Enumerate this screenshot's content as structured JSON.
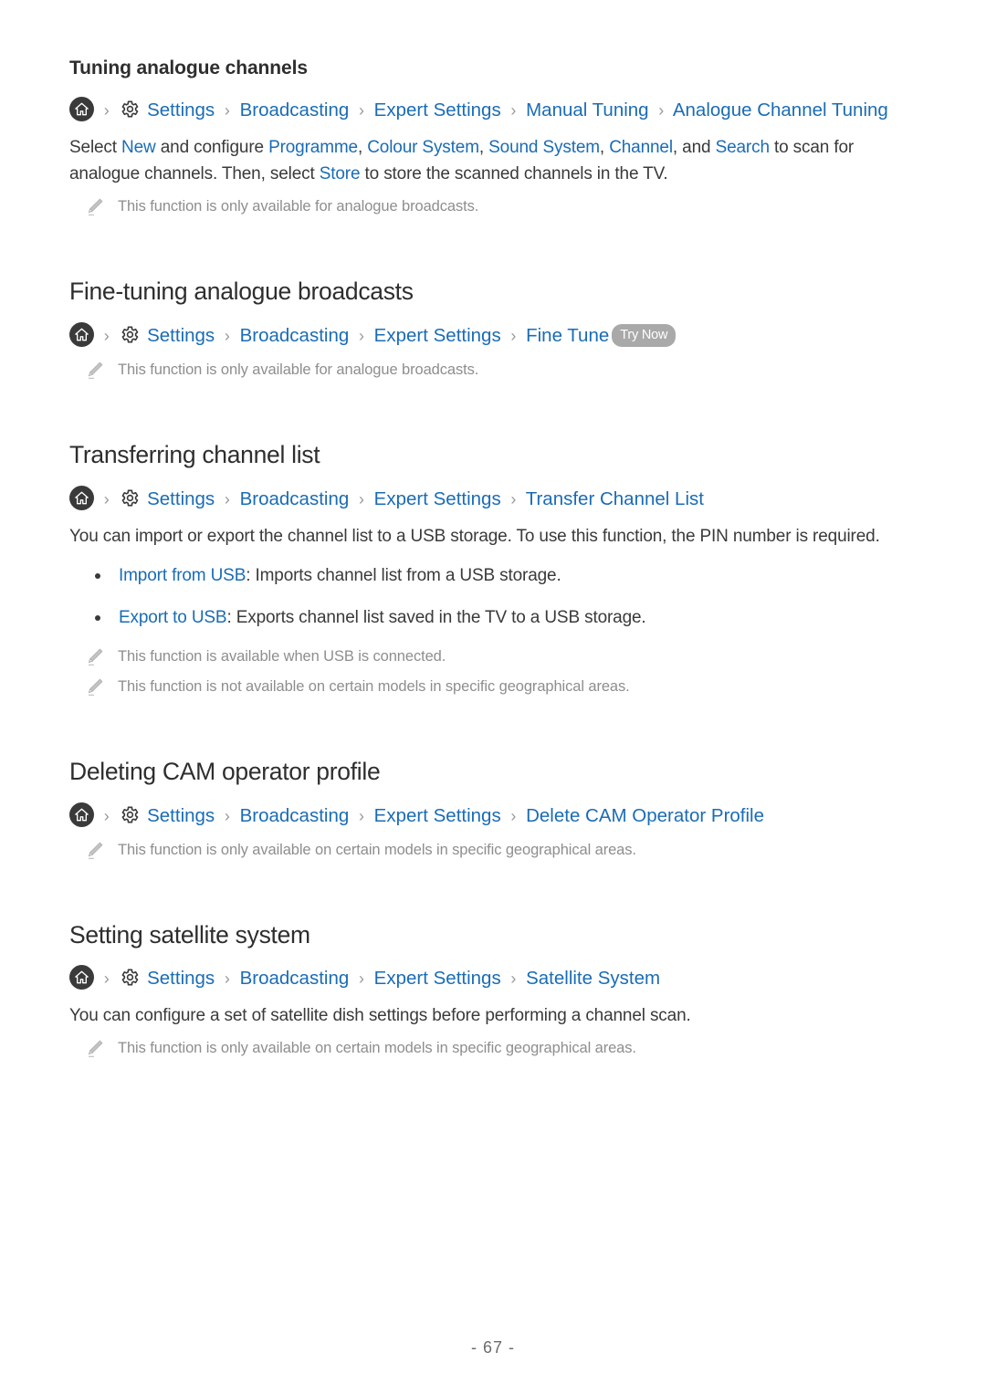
{
  "document": {
    "page_number": "- 67 -"
  },
  "icons": {
    "home": "home-icon",
    "gear": "gear-icon",
    "note": "pencil-note-icon",
    "separator": "›"
  },
  "colors": {
    "link": "#1a6cb5",
    "text": "#3a3a3a",
    "note_text": "#8e8e8e",
    "badge_bg": "#a9a9a9",
    "home_bg": "#3a3a3a"
  },
  "sections": [
    {
      "id": "tuning-analogue-channels",
      "heading": "Tuning analogue channels",
      "heading_level": "sub",
      "breadcrumb": {
        "crumbs": [
          "Settings",
          "Broadcasting",
          "Expert Settings",
          "Manual Tuning",
          "Analogue Channel Tuning"
        ],
        "badge": null
      },
      "body": {
        "prefix": "Select ",
        "link1": "New",
        "mid1": " and configure ",
        "link2": "Programme",
        "comma1": ", ",
        "link3": "Colour System",
        "comma2": ", ",
        "link4": "Sound System",
        "comma3": ", ",
        "link5": "Channel",
        "mid2": ", and ",
        "link6": "Search",
        "mid3": " to scan for analogue channels. Then, select ",
        "link7": "Store",
        "suffix": " to store the scanned channels in the TV."
      },
      "notes": [
        "This function is only available for analogue broadcasts."
      ]
    },
    {
      "id": "fine-tuning-analogue-broadcasts",
      "heading": "Fine-tuning analogue broadcasts",
      "heading_level": "section",
      "breadcrumb": {
        "crumbs": [
          "Settings",
          "Broadcasting",
          "Expert Settings",
          "Fine Tune"
        ],
        "badge": "Try Now"
      },
      "notes": [
        "This function is only available for analogue broadcasts."
      ]
    },
    {
      "id": "transferring-channel-list",
      "heading": "Transferring channel list",
      "heading_level": "section",
      "breadcrumb": {
        "crumbs": [
          "Settings",
          "Broadcasting",
          "Expert Settings",
          "Transfer Channel List"
        ],
        "badge": null
      },
      "intro": "You can import or export the channel list to a USB storage. To use this function, the PIN number is required.",
      "bullets": [
        {
          "term": "Import from USB",
          "desc": ": Imports channel list from a USB storage."
        },
        {
          "term": "Export to USB",
          "desc": ": Exports channel list saved in the TV to a USB storage."
        }
      ],
      "notes": [
        "This function is available when USB is connected.",
        "This function is not available on certain models in specific geographical areas."
      ]
    },
    {
      "id": "deleting-cam-operator-profile",
      "heading": "Deleting CAM operator profile",
      "heading_level": "section",
      "breadcrumb": {
        "crumbs": [
          "Settings",
          "Broadcasting",
          "Expert Settings",
          "Delete CAM Operator Profile"
        ],
        "badge": null
      },
      "notes": [
        "This function is only available on certain models in specific geographical areas."
      ]
    },
    {
      "id": "setting-satellite-system",
      "heading": "Setting satellite system",
      "heading_level": "section",
      "breadcrumb": {
        "crumbs": [
          "Settings",
          "Broadcasting",
          "Expert Settings",
          "Satellite System"
        ],
        "badge": null
      },
      "intro": "You can configure a set of satellite dish settings before performing a channel scan.",
      "notes": [
        "This function is only available on certain models in specific geographical areas."
      ]
    }
  ]
}
